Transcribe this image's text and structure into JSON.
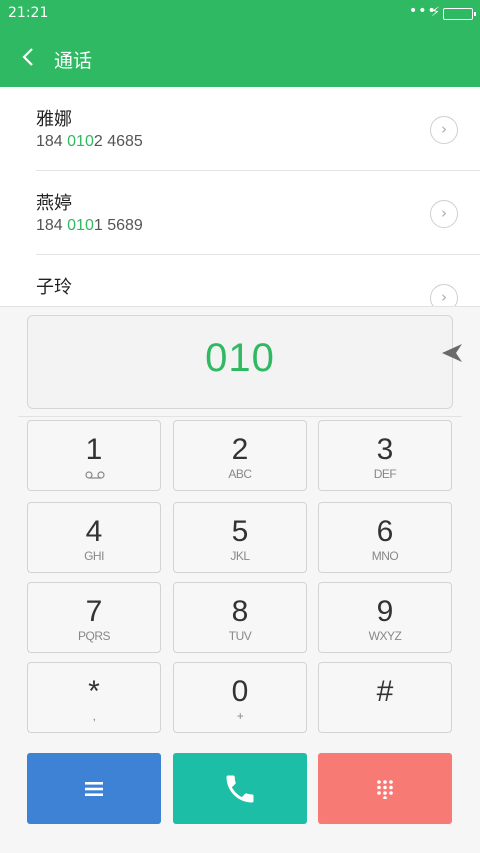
{
  "status_bar": {
    "time": "21:21",
    "dots": "•••",
    "bolt": "⚡"
  },
  "header": {
    "back_glyph": "‹",
    "title": "通话"
  },
  "contacts": [
    {
      "name": "雅娜",
      "number_prefix": "184 ",
      "number_match": "010",
      "number_suffix": "2 4685"
    },
    {
      "name": "燕婷",
      "number_prefix": "184 ",
      "number_match": "010",
      "number_suffix": "1 5689"
    },
    {
      "name": "子玲",
      "number_prefix": "",
      "number_match": "",
      "number_suffix": ""
    }
  ],
  "contact_arrow": "›",
  "dial_display": {
    "value": "010"
  },
  "keypad": [
    {
      "digit": "1",
      "letters": ""
    },
    {
      "digit": "2",
      "letters": "ABC"
    },
    {
      "digit": "3",
      "letters": "DEF"
    },
    {
      "digit": "4",
      "letters": "GHI"
    },
    {
      "digit": "5",
      "letters": "JKL"
    },
    {
      "digit": "6",
      "letters": "MNO"
    },
    {
      "digit": "7",
      "letters": "PQRS"
    },
    {
      "digit": "8",
      "letters": "TUV"
    },
    {
      "digit": "9",
      "letters": "WXYZ"
    },
    {
      "digit": "*",
      "letters": ","
    },
    {
      "digit": "0",
      "letters": "+"
    },
    {
      "digit": "#",
      "letters": ""
    }
  ],
  "actions": {
    "menu_icon": "menu-icon",
    "call_icon": "phone-icon",
    "keypad_icon": "dialpad-icon"
  },
  "colors": {
    "header": "#2fb962",
    "match": "#2fb962",
    "menu": "#3d82d4",
    "call": "#1cbea5",
    "keypad_toggle": "#f87a75"
  }
}
